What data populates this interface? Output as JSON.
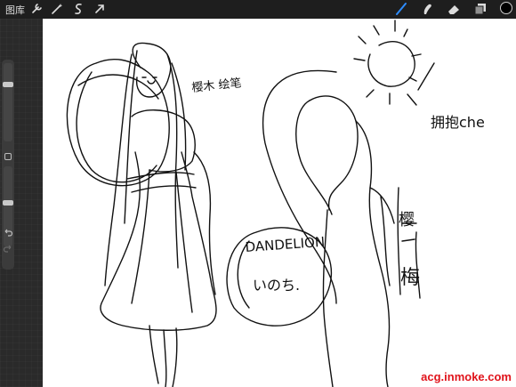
{
  "toolbar": {
    "gallery_label": "图库",
    "left_icons": [
      "wrench-icon",
      "magic-wand-icon",
      "selection-icon",
      "transform-arrow-icon"
    ],
    "right_icons": [
      "brush-icon",
      "smudge-icon",
      "eraser-icon",
      "layers-icon"
    ],
    "active_tool": "brush-icon",
    "active_color": "#000000",
    "accent_color": "#2d8cff"
  },
  "sidebar": {
    "brush_size_level": 0.25,
    "opacity_level": 0.45,
    "modify_icon": "square-icon",
    "undo_icon": "undo-icon",
    "redo_icon": "redo-icon"
  },
  "canvas": {
    "handwriting": {
      "top_left_note": "樱木 绘笔",
      "dandelion": "DANDELION",
      "inochi": "いのち.",
      "right_note": "拥抱che",
      "side_note": "樱",
      "side_note_2": "梅"
    }
  },
  "watermark": {
    "text": "acg.inmoke.com",
    "color": "#e0131b"
  }
}
